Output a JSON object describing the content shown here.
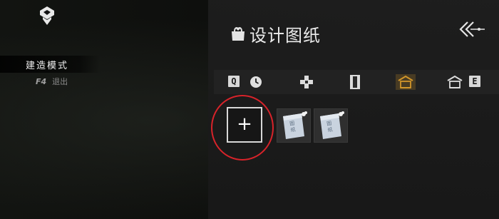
{
  "hud": {
    "mode_label": "建造模式",
    "exit_key": "F4",
    "exit_label": "退出"
  },
  "panel": {
    "title": "设计图纸",
    "title_icon": "blueprint-bag-icon",
    "back_icon": "double-chevron-back-icon",
    "tabs": [
      {
        "key": "Q",
        "icon": "clock-icon",
        "active": false
      },
      {
        "icon": "plus-cross-icon",
        "active": false
      },
      {
        "icon": "pillar-icon",
        "active": false
      },
      {
        "icon": "roof-house-icon",
        "active": true
      },
      {
        "icon": "roof-house-outline-icon",
        "key": "E",
        "active": false
      }
    ],
    "slots": [
      {
        "type": "add",
        "label": "+"
      },
      {
        "type": "blueprint",
        "scroll_text": "图纸"
      },
      {
        "type": "blueprint",
        "scroll_text": "图纸"
      }
    ]
  },
  "colors": {
    "accent": "#d2962a",
    "highlight_circle": "#d8232a",
    "panel_bg": "#1e1e1e"
  }
}
